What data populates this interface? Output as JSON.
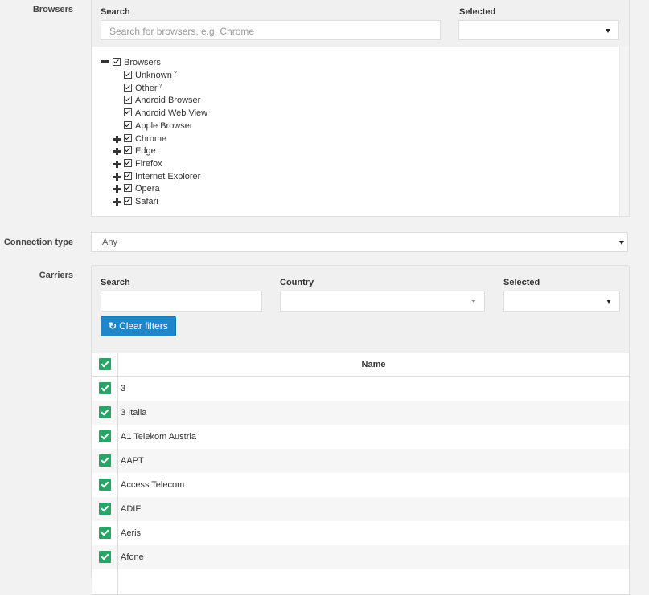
{
  "browsers": {
    "label": "Browsers",
    "search_label": "Search",
    "search_placeholder": "Search for browsers, e.g. Chrome",
    "selected_label": "Selected",
    "selected_value": "",
    "tree": {
      "root": "Browsers",
      "children": [
        {
          "label": "Unknown",
          "sup": "?",
          "expandable": false
        },
        {
          "label": "Other",
          "sup": "?",
          "expandable": false
        },
        {
          "label": "Android Browser",
          "expandable": false
        },
        {
          "label": "Android Web View",
          "expandable": false
        },
        {
          "label": "Apple Browser",
          "expandable": false
        },
        {
          "label": "Chrome",
          "expandable": true
        },
        {
          "label": "Edge",
          "expandable": true
        },
        {
          "label": "Firefox",
          "expandable": true
        },
        {
          "label": "Internet Explorer",
          "expandable": true
        },
        {
          "label": "Opera",
          "expandable": true
        },
        {
          "label": "Safari",
          "expandable": true
        }
      ]
    }
  },
  "connection": {
    "label": "Connection type",
    "value": "Any"
  },
  "carriers": {
    "label": "Carriers",
    "search_label": "Search",
    "search_value": "",
    "country_label": "Country",
    "country_value": "",
    "selected_label": "Selected",
    "selected_value": "",
    "clear_button": "Clear filters",
    "table": {
      "header": "Name",
      "rows": [
        "3",
        "3 Italia",
        "A1 Telekom Austria",
        "AAPT",
        "Access Telecom",
        "ADIF",
        "Aeris",
        "Afone"
      ]
    }
  },
  "colors": {
    "check_green": "#27a567",
    "button_blue": "#1f87c9"
  }
}
